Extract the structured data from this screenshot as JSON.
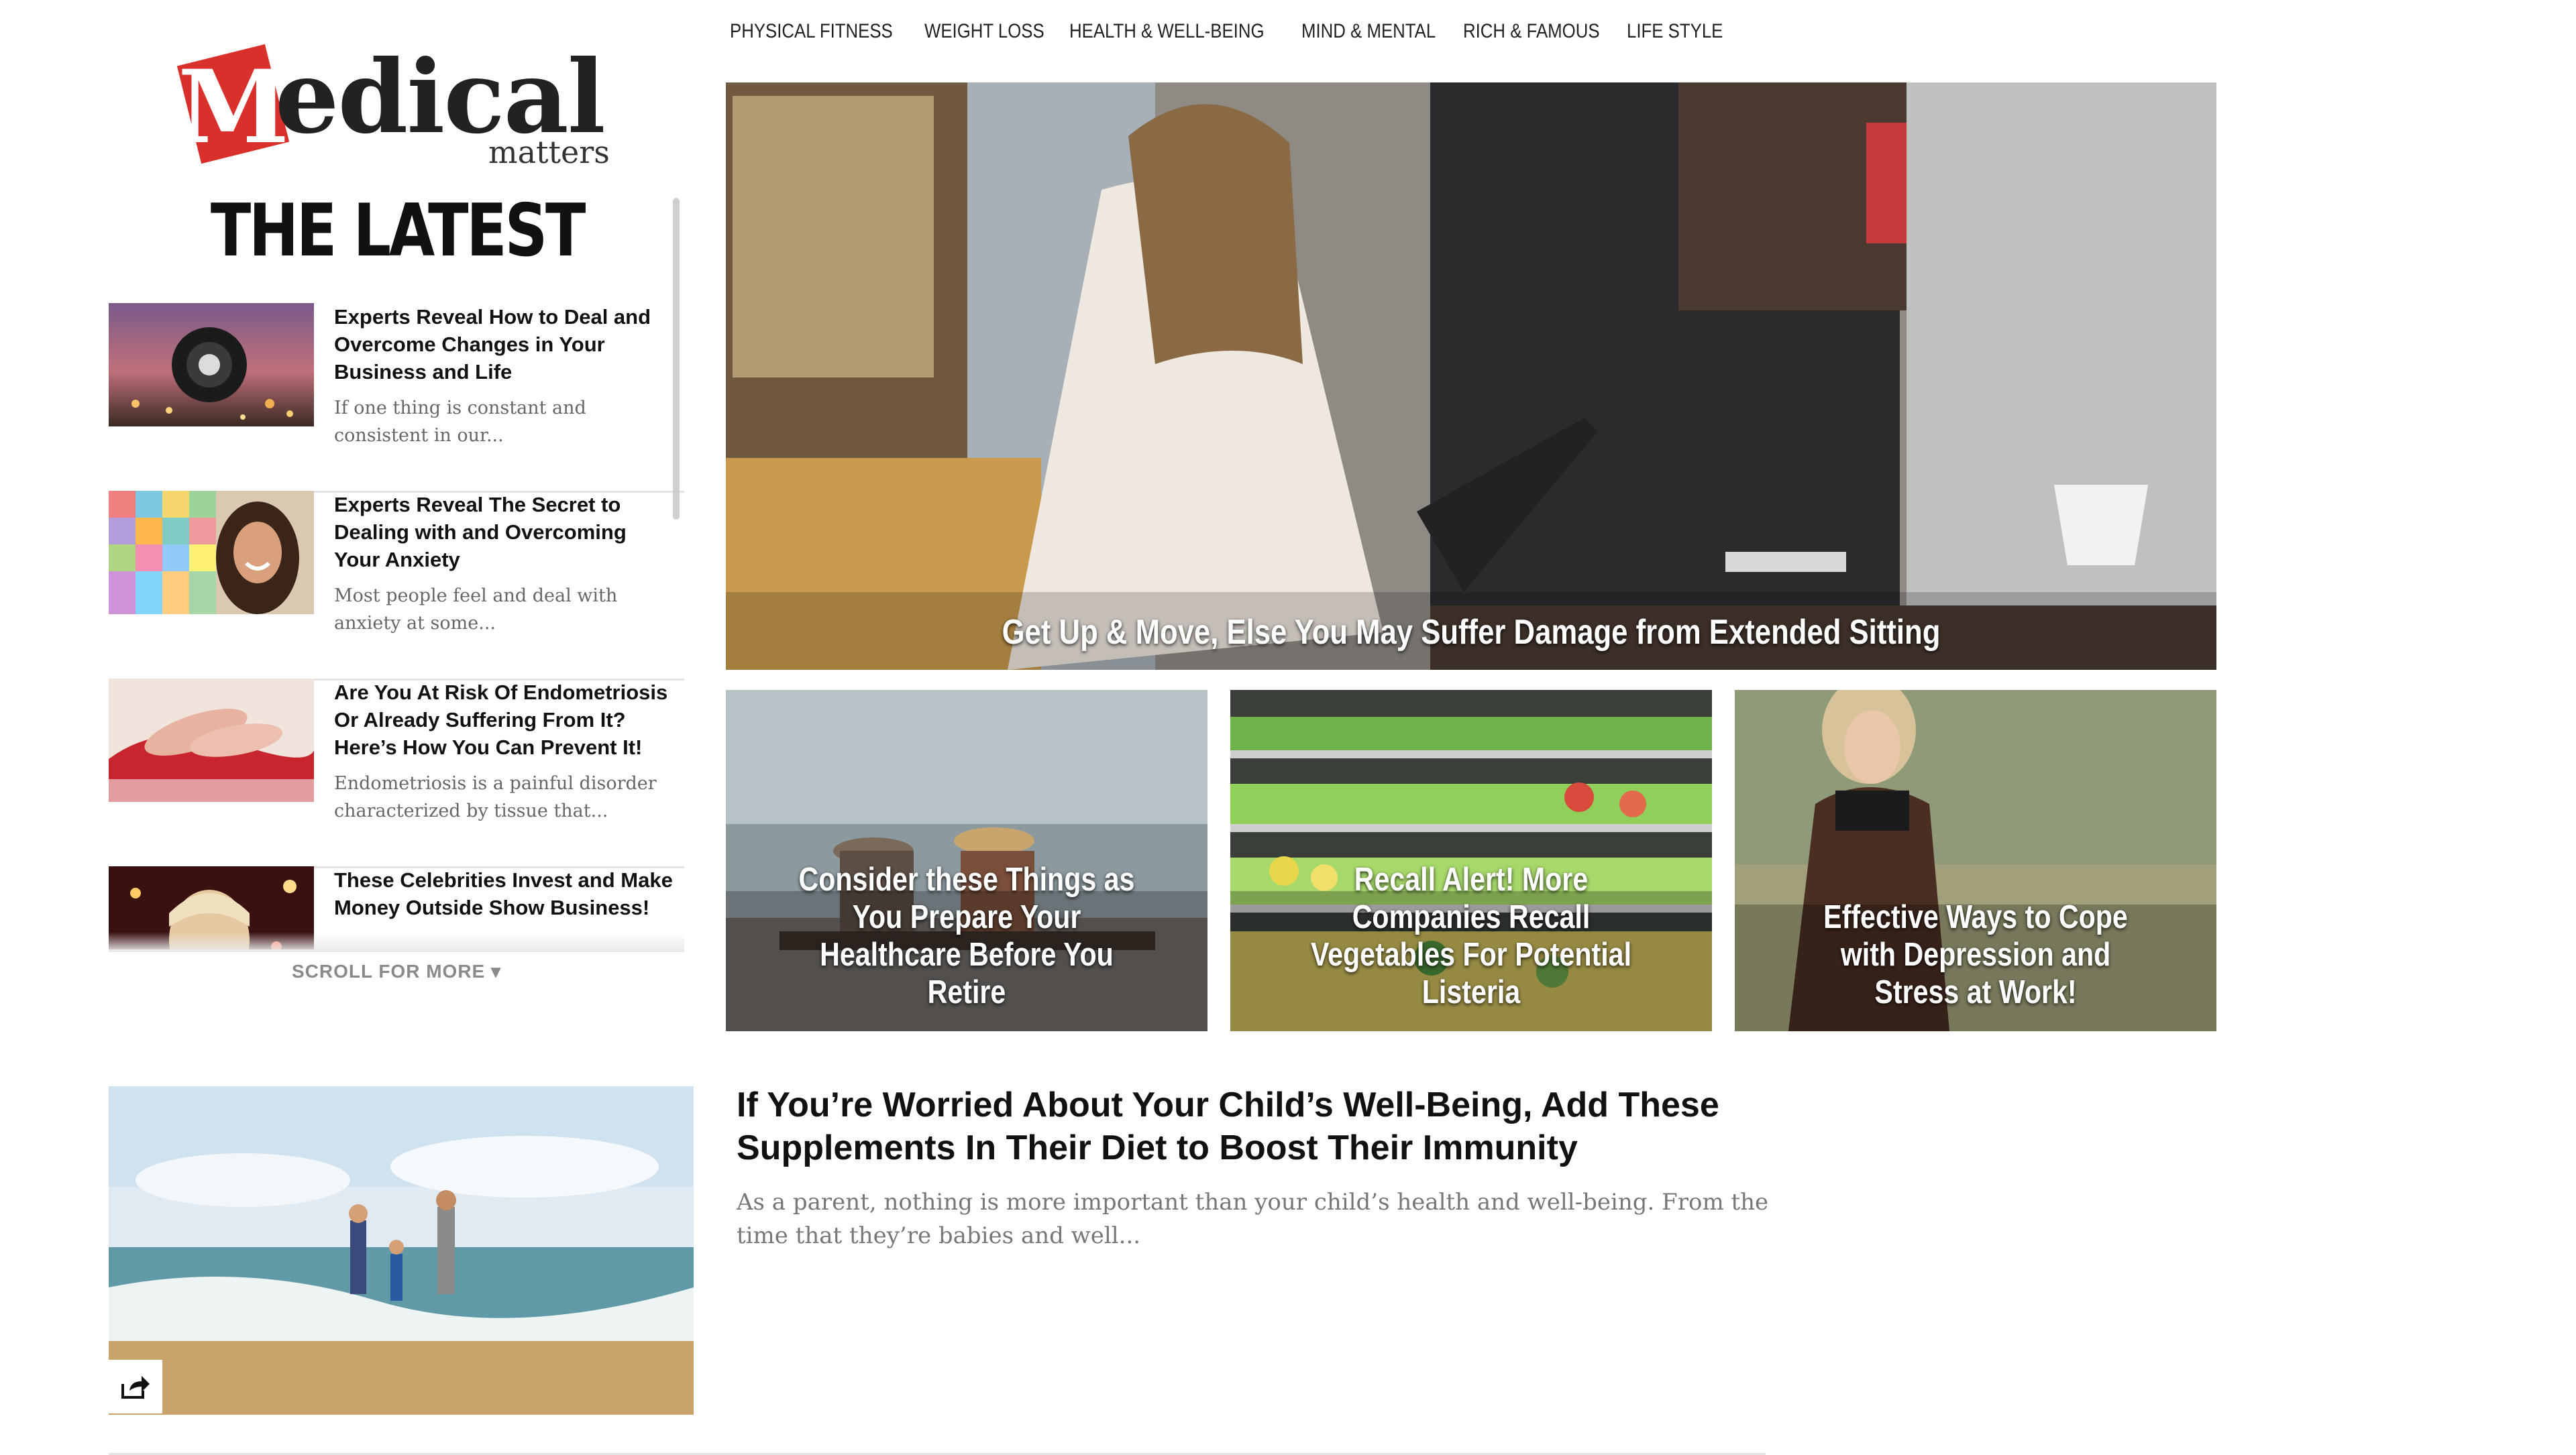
{
  "logo": {
    "letter": "M",
    "word": "edical",
    "tagline": "matters",
    "brand_color": "#d9302c"
  },
  "latest": {
    "heading": "THE LATEST",
    "items": [
      {
        "title": "Experts Reveal How to Deal and Overcome Changes in Your Business and Life",
        "excerpt": "If one thing is constant and consistent in our..."
      },
      {
        "title": "Experts Reveal The Secret to Dealing with and Overcoming Your Anxiety",
        "excerpt": "Most people feel and deal with anxiety at some..."
      },
      {
        "title": "Are You At Risk Of Endometriosis Or Already Suffering From It? Here’s How You Can Prevent It!",
        "excerpt": "Endometriosis is a painful disorder characterized by tissue that..."
      },
      {
        "title": "These Celebrities Invest and Make Money Outside Show Business!",
        "excerpt": ""
      }
    ],
    "scroll_more": "SCROLL FOR MORE ▾"
  },
  "nav": {
    "items": [
      "PHYSICAL FITNESS",
      "WEIGHT LOSS",
      "HEALTH & WELL-BEING",
      "MIND & MENTAL",
      "RICH & FAMOUS",
      "LIFE STYLE"
    ]
  },
  "hero": {
    "title": "Get Up & Move, Else You May Suffer Damage from Extended Sitting"
  },
  "cards": [
    {
      "title": "Consider these Things as You Prepare Your Healthcare Before You Retire"
    },
    {
      "title": "Recall Alert! More Companies Recall Vegetables For Potential Listeria"
    },
    {
      "title": "Effective Ways to Cope with Depression and Stress at Work!"
    }
  ],
  "feature": {
    "title": "If You’re Worried About Your Child’s Well-Being, Add These Supplements In Their Diet to Boost Their Immunity",
    "excerpt": "As a parent, nothing is more important than your child’s health and well-being. From the time that they’re babies and well...",
    "share_icon": "share-icon"
  }
}
